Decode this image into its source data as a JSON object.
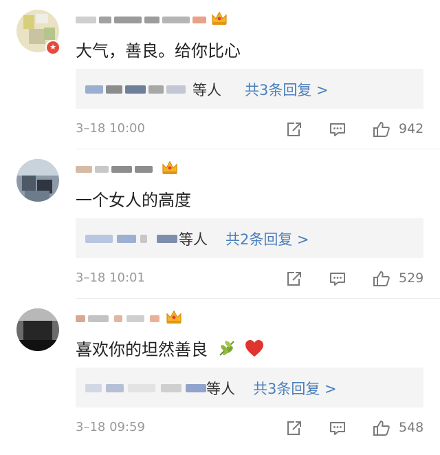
{
  "comments": [
    {
      "text": "大气，善良。给你比心",
      "reply": {
        "suffix": "等人",
        "link": "共3条回复 >"
      },
      "timestamp": "3–18 10:00",
      "likes": "942"
    },
    {
      "text": "一个女人的高度",
      "reply": {
        "suffix": "等人",
        "link": "共2条回复 >"
      },
      "timestamp": "3–18 10:01",
      "likes": "529"
    },
    {
      "text": "喜欢你的坦然善良",
      "reply": {
        "suffix": "等人",
        "link": "共3条回复 >"
      },
      "timestamp": "3–18 09:59",
      "likes": "548"
    }
  ],
  "icons": [
    "vip-badge-icon",
    "crown-icon",
    "share-icon",
    "comment-icon",
    "thumbs-up-icon",
    "leaf-emoji-icon",
    "heart-emoji-icon"
  ],
  "colors": {
    "link": "#4a7fbc",
    "heart": "#e0342f",
    "badge": "#e64a3c",
    "timestamp": "#999999"
  }
}
